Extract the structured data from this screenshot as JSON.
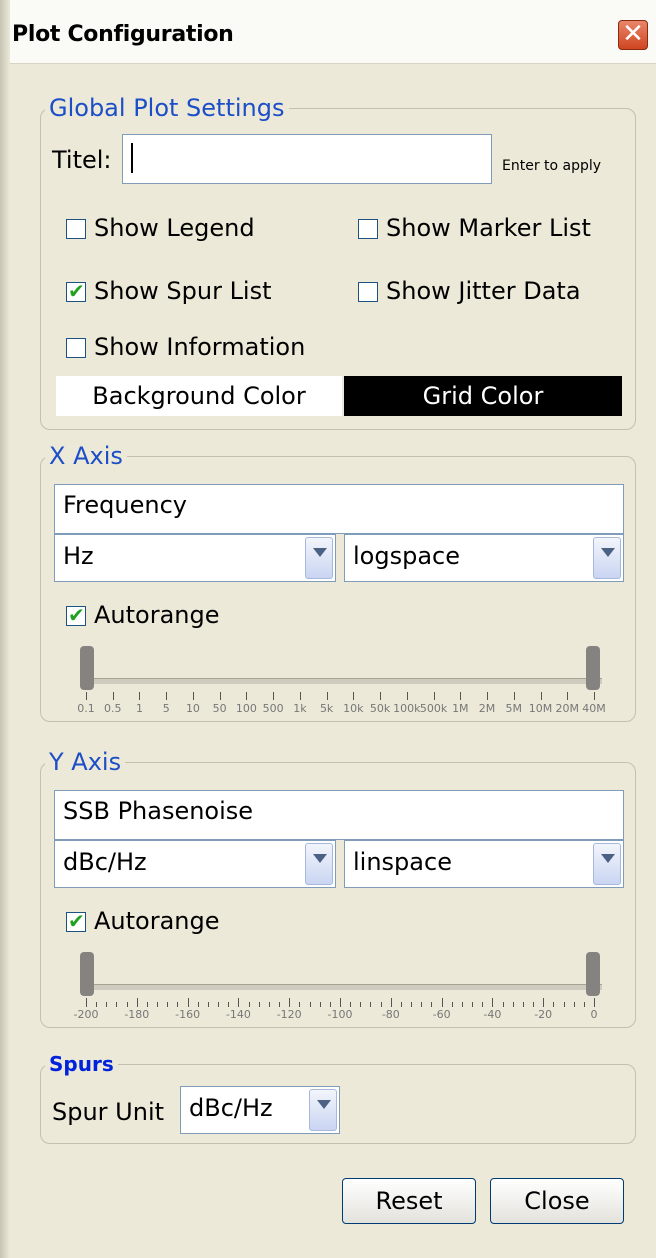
{
  "window": {
    "title": "Plot Configuration",
    "close_glyph": "✕",
    "colors": {
      "background": "#ece9d8",
      "title_bg": "#fafaf6",
      "close_bg": "#d3512c",
      "legend_text": "#1c4ec8",
      "check": "#21a121"
    }
  },
  "global": {
    "legend": "Global Plot Settings",
    "title_label": "Titel:",
    "title_value": "",
    "apply_hint": "Enter to apply",
    "show_legend": {
      "label": "Show Legend",
      "checked": false
    },
    "show_marker_list": {
      "label": "Show Marker List",
      "checked": false
    },
    "show_spur_list": {
      "label": "Show Spur List",
      "checked": true
    },
    "show_jitter_data": {
      "label": "Show Jitter Data",
      "checked": false
    },
    "show_information": {
      "label": "Show Information",
      "checked": false
    },
    "background_color_label": "Background Color",
    "grid_color_label": "Grid Color",
    "background_color": "#ffffff",
    "grid_color": "#000000"
  },
  "x_axis": {
    "legend": "X Axis",
    "label_value": "Frequency",
    "unit": "Hz",
    "scale": "logspace",
    "autorange": {
      "label": "Autorange",
      "checked": true
    },
    "tick_labels": [
      "0.1",
      "0.5",
      "1",
      "5",
      "10",
      "50",
      "100",
      "500",
      "1k",
      "5k",
      "10k",
      "50k",
      "100k",
      "500k",
      "1M",
      "2M",
      "5M",
      "10M",
      "20M",
      "40M"
    ]
  },
  "y_axis": {
    "legend": "Y Axis",
    "label_value": "SSB Phasenoise",
    "unit": "dBc/Hz",
    "scale": "linspace",
    "autorange": {
      "label": "Autorange",
      "checked": true
    },
    "tick_labels": [
      "-200",
      "-180",
      "-160",
      "-140",
      "-120",
      "-100",
      "-80",
      "-60",
      "-40",
      "-20",
      "0"
    ]
  },
  "spurs": {
    "legend": "Spurs",
    "unit_label": "Spur Unit",
    "unit": "dBc/Hz"
  },
  "buttons": {
    "reset": "Reset",
    "close": "Close"
  },
  "icons": [
    "close-icon",
    "chevron-down-icon",
    "check-icon"
  ]
}
